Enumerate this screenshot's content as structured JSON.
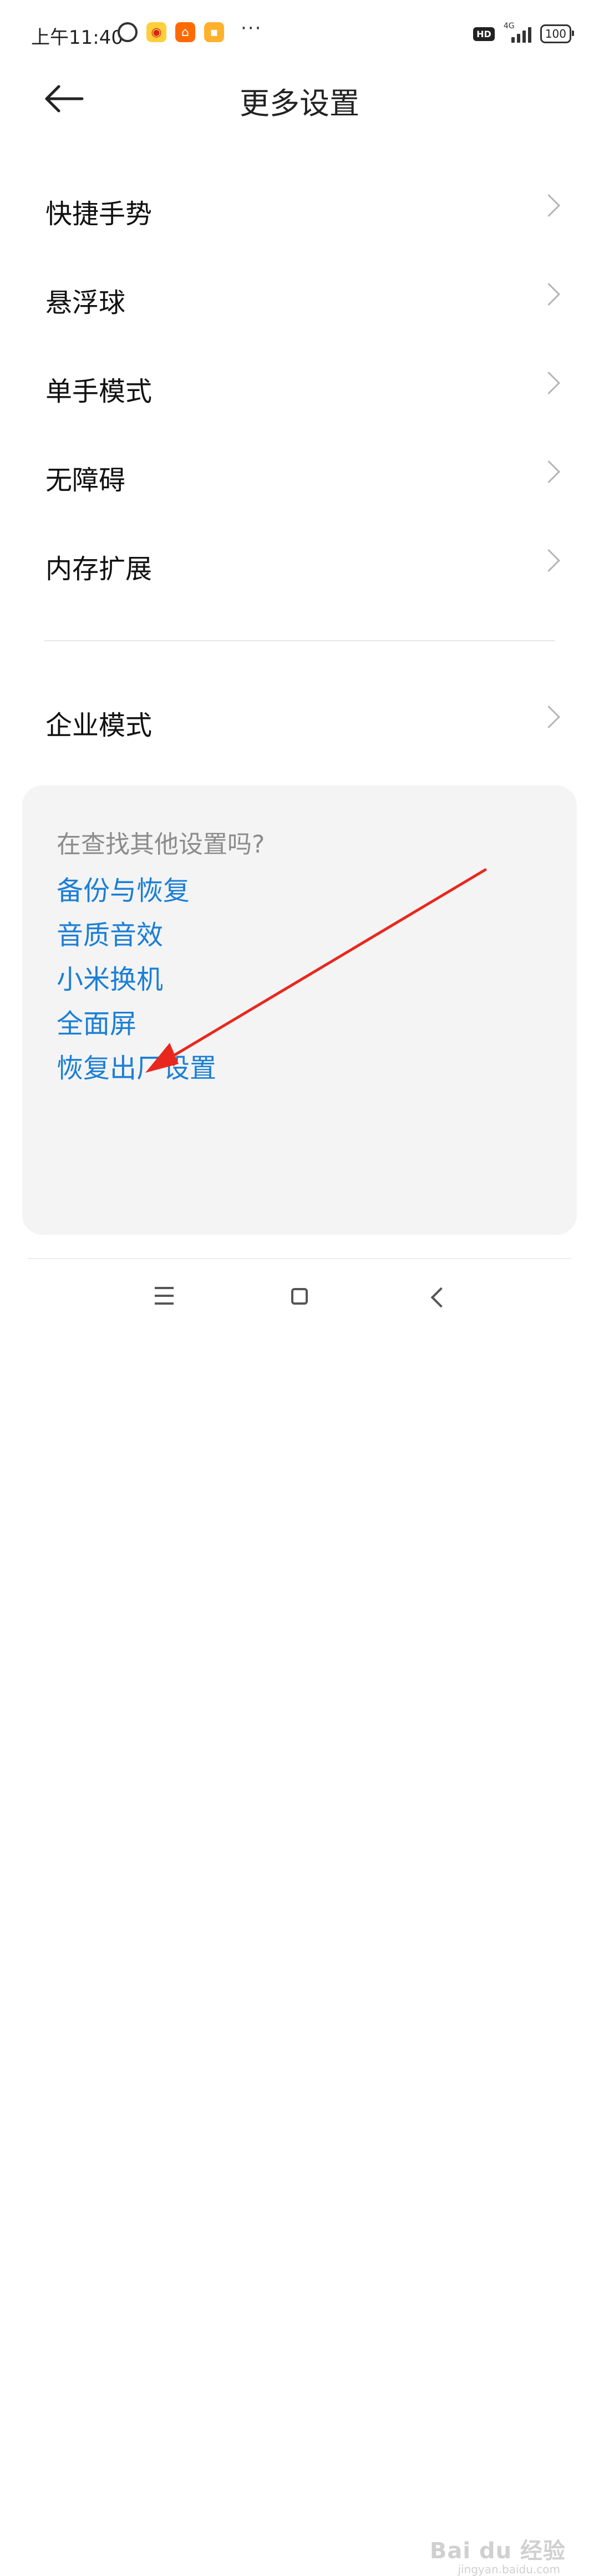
{
  "status_bar": {
    "time": "上午11:40",
    "network": "4G",
    "hd": "HD",
    "battery": "100",
    "overflow": "···",
    "icons": [
      "alarm-icon",
      "weibo-icon",
      "taobao-icon",
      "message-icon"
    ]
  },
  "header": {
    "title": "更多设置",
    "back_icon": "arrow-left-icon"
  },
  "settings": {
    "items": [
      {
        "label": "快捷手势"
      },
      {
        "label": "悬浮球"
      },
      {
        "label": "单手模式"
      },
      {
        "label": "无障碍"
      },
      {
        "label": "内存扩展"
      }
    ],
    "enterprise": {
      "label": "企业模式"
    }
  },
  "suggestions": {
    "title": "在查找其他设置吗?",
    "links": [
      {
        "label": "备份与恢复"
      },
      {
        "label": "音质音效"
      },
      {
        "label": "小米换机"
      },
      {
        "label": "全面屏"
      },
      {
        "label": "恢复出厂设置"
      }
    ]
  },
  "watermark": {
    "main": "Bai du 经验",
    "sub": "jingyan.baidu.com"
  },
  "colors": {
    "link": "#1b7fd6",
    "annotation_arrow": "#e8281e",
    "card_bg": "#f4f4f4"
  }
}
